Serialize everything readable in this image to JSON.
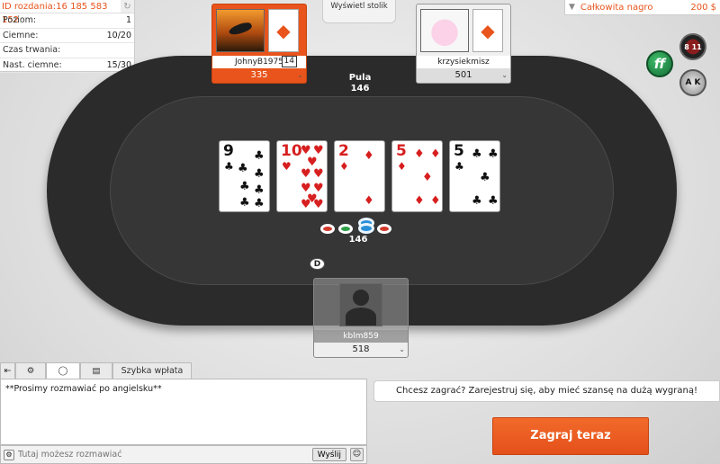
{
  "hand_info": {
    "hand_id": "ID rozdania:16 185 583 152",
    "rows": [
      {
        "label": "Poziom:",
        "value": "1"
      },
      {
        "label": "Ciemne:",
        "value": "10/20"
      },
      {
        "label": "Czas trwania:",
        "value": ""
      },
      {
        "label": "Nast. ciemne:",
        "value": "15/30"
      }
    ]
  },
  "total_prize": {
    "label": "Całkowita nagro",
    "amount": "200 $"
  },
  "view_table": {
    "label": "Wyświetl stolik"
  },
  "pot": {
    "label": "Pula",
    "amount": "146"
  },
  "chip_total": "146",
  "dealer_button": "D",
  "community_cards": [
    {
      "rank": "9",
      "suit": "♣",
      "color": "black"
    },
    {
      "rank": "10",
      "suit": "♥",
      "color": "red"
    },
    {
      "rank": "2",
      "suit": "♦",
      "color": "red"
    },
    {
      "rank": "5",
      "suit": "♦",
      "color": "red"
    },
    {
      "rank": "5",
      "suit": "♣",
      "color": "black"
    }
  ],
  "seats": {
    "johny": {
      "name": "JohnyB1975",
      "timer": "14",
      "stack": "335"
    },
    "krzy": {
      "name": "krzysiekmisz",
      "stack": "501"
    },
    "kblm": {
      "name": "kblm859",
      "stack": "518"
    }
  },
  "side_icons": {
    "ff": "ff",
    "roulette": "8 11",
    "cards": "A K"
  },
  "chat": {
    "tabs": {
      "quick_deposit": "Szybka wpłata"
    },
    "message": "**Prosimy rozmawiać po angielsku**",
    "input_placeholder": "Tutaj możesz rozmawiać",
    "send_label": "Wyślij"
  },
  "register": {
    "banner": "Chcesz zagrać? Zarejestruj się, aby mieć szansę na dużą wygraną!",
    "play_now": "Zagraj teraz"
  },
  "colors": {
    "accent": "#e8541c",
    "table": "#2b2b2b"
  }
}
